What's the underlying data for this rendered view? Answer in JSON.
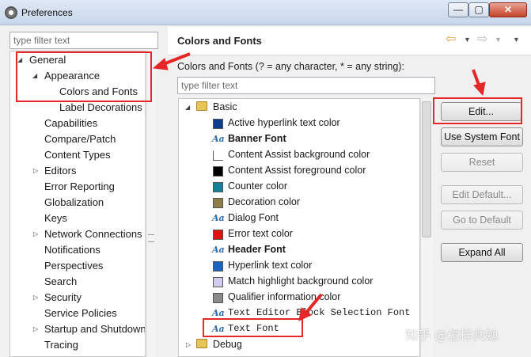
{
  "window": {
    "title": "Preferences",
    "minimize_glyph": "—",
    "maximize_glyph": "▢",
    "close_glyph": "✕"
  },
  "left": {
    "filter_placeholder": "type filter text",
    "tree": [
      {
        "label": "General"
      },
      {
        "label": "Appearance"
      },
      {
        "label": "Colors and Fonts"
      },
      {
        "label": "Label Decorations"
      },
      {
        "label": "Capabilities"
      },
      {
        "label": "Compare/Patch"
      },
      {
        "label": "Content Types"
      },
      {
        "label": "Editors"
      },
      {
        "label": "Error Reporting"
      },
      {
        "label": "Globalization"
      },
      {
        "label": "Keys"
      },
      {
        "label": "Network Connections"
      },
      {
        "label": "Notifications"
      },
      {
        "label": "Perspectives"
      },
      {
        "label": "Search"
      },
      {
        "label": "Security"
      },
      {
        "label": "Service Policies"
      },
      {
        "label": "Startup and Shutdown"
      },
      {
        "label": "Tracing"
      }
    ]
  },
  "right": {
    "page_title": "Colors and Fonts",
    "description": "Colors and Fonts (? = any character, * = any string):",
    "filter_placeholder": "type filter text",
    "category": "Basic",
    "items": [
      {
        "label": "Active hyperlink text color",
        "color": "#0d3d8f"
      },
      {
        "label": "Banner Font"
      },
      {
        "label": "Content Assist background color",
        "color": "#ffffff"
      },
      {
        "label": "Content Assist foreground color",
        "color": "#000000"
      },
      {
        "label": "Counter color",
        "color": "#12829a"
      },
      {
        "label": "Decoration color",
        "color": "#8d7d48"
      },
      {
        "label": "Dialog Font"
      },
      {
        "label": "Error text color",
        "color": "#e01010"
      },
      {
        "label": "Header Font"
      },
      {
        "label": "Hyperlink text color",
        "color": "#1a63c2"
      },
      {
        "label": "Match highlight background color",
        "color": "#d2cdf0"
      },
      {
        "label": "Qualifier information color",
        "color": "#8a8a8a"
      },
      {
        "label": "Text Editor Block Selection Font"
      },
      {
        "label": "Text Font"
      }
    ],
    "next_category": "Debug"
  },
  "buttons": {
    "edit": "Edit...",
    "use_system_font": "Use System Font",
    "reset": "Reset",
    "edit_default": "Edit Default...",
    "go_to_default": "Go to Default",
    "expand_all": "Expand All"
  },
  "watermark": "知乎 @怎样共勉",
  "colors": {
    "annotation": "#e52727",
    "font_icon": "#2f6db1"
  }
}
